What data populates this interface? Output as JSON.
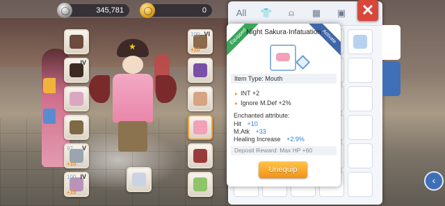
{
  "currency": {
    "zeny": {
      "value": "345,781",
      "icon": "zeny-coin-icon"
    },
    "credit": {
      "value": "0",
      "icon": "gold-coin-icon"
    }
  },
  "equipment": {
    "left_slots": [
      {
        "id": "slot-left-1",
        "refine": "",
        "grade": "",
        "plus": "",
        "color": "#6d4b3e"
      },
      {
        "id": "slot-left-2",
        "refine": "",
        "grade": "IV",
        "plus": "",
        "color": "#3c2a22"
      },
      {
        "id": "slot-left-3",
        "refine": "",
        "grade": "",
        "plus": "",
        "color": "#d9a7c0"
      },
      {
        "id": "slot-left-4",
        "refine": "",
        "grade": "",
        "plus": "",
        "color": "#7d6a44"
      },
      {
        "id": "slot-left-5",
        "refine": "97",
        "grade": "V",
        "plus": "+10",
        "color": "#9aa5b0"
      },
      {
        "id": "slot-left-6",
        "refine": "100",
        "grade": "IV",
        "plus": "+10",
        "color": "#b894b8"
      }
    ],
    "right_slots": [
      {
        "id": "slot-right-1",
        "refine": "100",
        "grade": "VI",
        "plus": "+10",
        "color": "#8b6a4a"
      },
      {
        "id": "slot-right-2",
        "refine": "",
        "grade": "",
        "plus": "",
        "color": "#7a4fa8"
      },
      {
        "id": "slot-right-3",
        "refine": "",
        "grade": "",
        "plus": "",
        "color": "#d6a383"
      },
      {
        "id": "slot-right-4",
        "refine": "",
        "grade": "",
        "plus": "",
        "color": "#f3a1b8"
      },
      {
        "id": "slot-right-5",
        "refine": "",
        "grade": "",
        "plus": "",
        "color": "#9a3a3a"
      },
      {
        "id": "slot-right-6",
        "refine": "",
        "grade": "",
        "plus": "",
        "color": "#8fc46a"
      }
    ],
    "center_slot": {
      "id": "slot-costume",
      "color": "#c9d3e2"
    }
  },
  "panel": {
    "tabs": [
      {
        "label": "All",
        "icon": ""
      },
      {
        "label": "",
        "icon": "shirt-icon"
      },
      {
        "label": "",
        "icon": "bag-icon"
      },
      {
        "label": "",
        "icon": "grid-icon"
      },
      {
        "label": "",
        "icon": "card-icon"
      }
    ],
    "close_icon": "close-icon",
    "grid_items": [
      {
        "color": "#e8b77a"
      },
      {
        "color": "#b7d2f0"
      }
    ]
  },
  "tooltip": {
    "equipped_badge": "Equipped",
    "activated_badge": "Activate",
    "title": "Night Sakura·Infatuation",
    "item_type": "Item Type: Mouth",
    "base_stats": [
      "INT +2",
      "Ignore M.Def +2%"
    ],
    "enchant_heading": "Enchanted attribute:",
    "enchants": [
      {
        "name": "Hit",
        "value": "+10"
      },
      {
        "name": "M.Atk",
        "value": "+33"
      },
      {
        "name": "Healing Increase",
        "value": "+2.9%"
      }
    ],
    "deposit": "Deposit Reward: Max HP +60",
    "unequip_label": "Unequip"
  }
}
